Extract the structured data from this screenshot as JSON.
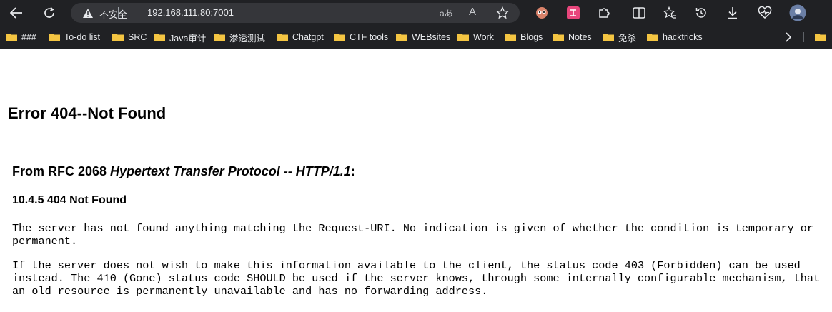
{
  "browser": {
    "security_label": "不安全",
    "url": "192.168.111.80:7001",
    "read_aloud_glyph": "aあ",
    "font_glyph": "A",
    "icons": [
      "back-arrow-icon",
      "refresh-icon",
      "warning-icon",
      "translate-icon",
      "read-aloud-icon",
      "star-icon",
      "extension-owl-icon",
      "extension-pink-icon",
      "puzzle-icon",
      "split-screen-icon",
      "favorites-icon",
      "history-icon",
      "download-icon",
      "heart-pulse-icon",
      "profile-avatar-icon"
    ]
  },
  "bookmarks": [
    {
      "label": "###"
    },
    {
      "label": "To-do list"
    },
    {
      "label": "SRC"
    },
    {
      "label": "Java审计"
    },
    {
      "label": "渗透测试"
    },
    {
      "label": "Chatgpt"
    },
    {
      "label": "CTF tools"
    },
    {
      "label": "WEBsites"
    },
    {
      "label": "Work"
    },
    {
      "label": "Blogs"
    },
    {
      "label": "Notes"
    },
    {
      "label": "免杀"
    },
    {
      "label": "hacktricks"
    }
  ],
  "page": {
    "title": "Error 404--Not Found",
    "rfc_prefix": "From RFC 2068 ",
    "rfc_italic": "Hypertext Transfer Protocol -- HTTP/1.1",
    "rfc_suffix": ":",
    "section": "10.4.5 404 Not Found",
    "para1_line1": "The server has not found anything matching the Request-URI. No indication is given of whether the condition is temporary or",
    "para1_line2": "permanent.",
    "para2_line1": "If the server does not wish to make this information available to the client, the status code 403 (Forbidden) can be used",
    "para2_line2": "instead. The 410 (Gone) status code SHOULD be used if the server knows, through some internally configurable mechanism, that",
    "para2_line3": "an old resource is permanently unavailable and has no forwarding address."
  },
  "colors": {
    "chrome_bg": "#202124",
    "omnibox_bg": "#35363a",
    "folder": "#f4c542",
    "chrome_text": "#e8eaed"
  }
}
